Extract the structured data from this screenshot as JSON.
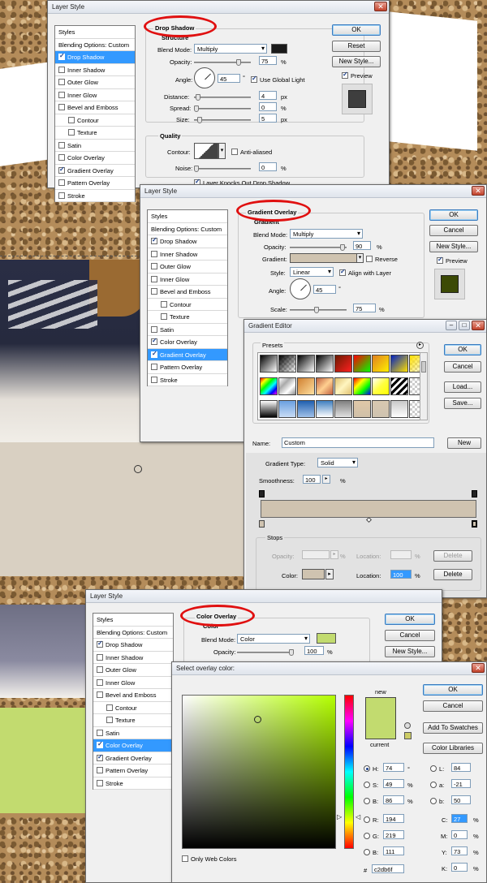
{
  "dialog1": {
    "title": "Layer Style",
    "section": "Drop Shadow",
    "subsection": "Structure",
    "styles_header": "Styles",
    "styles_items": [
      {
        "label": "Blending Options: Custom",
        "checkbox": false,
        "checked": false,
        "selected": false,
        "indent": false
      },
      {
        "label": "Drop Shadow",
        "checkbox": true,
        "checked": true,
        "selected": true,
        "indent": false
      },
      {
        "label": "Inner Shadow",
        "checkbox": true,
        "checked": false,
        "selected": false,
        "indent": false
      },
      {
        "label": "Outer Glow",
        "checkbox": true,
        "checked": false,
        "selected": false,
        "indent": false
      },
      {
        "label": "Inner Glow",
        "checkbox": true,
        "checked": false,
        "selected": false,
        "indent": false
      },
      {
        "label": "Bevel and Emboss",
        "checkbox": true,
        "checked": false,
        "selected": false,
        "indent": false
      },
      {
        "label": "Contour",
        "checkbox": true,
        "checked": false,
        "selected": false,
        "indent": true
      },
      {
        "label": "Texture",
        "checkbox": true,
        "checked": false,
        "selected": false,
        "indent": true
      },
      {
        "label": "Satin",
        "checkbox": true,
        "checked": false,
        "selected": false,
        "indent": false
      },
      {
        "label": "Color Overlay",
        "checkbox": true,
        "checked": false,
        "selected": false,
        "indent": false
      },
      {
        "label": "Gradient Overlay",
        "checkbox": true,
        "checked": true,
        "selected": false,
        "indent": false
      },
      {
        "label": "Pattern Overlay",
        "checkbox": true,
        "checked": false,
        "selected": false,
        "indent": false
      },
      {
        "label": "Stroke",
        "checkbox": true,
        "checked": false,
        "selected": false,
        "indent": false
      }
    ],
    "blend_mode_label": "Blend Mode:",
    "blend_mode": "Multiply",
    "opacity_label": "Opacity:",
    "opacity": "75",
    "angle_label": "Angle:",
    "angle": "45",
    "global_light": "Use Global Light",
    "distance_label": "Distance:",
    "distance": "4",
    "spread_label": "Spread:",
    "spread": "0",
    "size_label": "Size:",
    "size": "5",
    "quality": "Quality",
    "contour_label": "Contour:",
    "anti_aliased": "Anti-aliased",
    "noise_label": "Noise:",
    "noise": "0",
    "knockout": "Layer Knocks Out Drop Shadow",
    "ok": "OK",
    "reset": "Reset",
    "new_style": "New Style...",
    "preview": "Preview",
    "shadow_color": "#1a1a1a",
    "preview_color": "#3e3e3e"
  },
  "dialog2": {
    "title": "Layer Style",
    "section": "Gradient Overlay",
    "subsection": "Gradient",
    "styles_header": "Styles",
    "styles_items": [
      {
        "label": "Blending Options: Custom",
        "checkbox": false,
        "checked": false,
        "selected": false,
        "indent": false
      },
      {
        "label": "Drop Shadow",
        "checkbox": true,
        "checked": true,
        "selected": false,
        "indent": false
      },
      {
        "label": "Inner Shadow",
        "checkbox": true,
        "checked": false,
        "selected": false,
        "indent": false
      },
      {
        "label": "Outer Glow",
        "checkbox": true,
        "checked": false,
        "selected": false,
        "indent": false
      },
      {
        "label": "Inner Glow",
        "checkbox": true,
        "checked": false,
        "selected": false,
        "indent": false
      },
      {
        "label": "Bevel and Emboss",
        "checkbox": true,
        "checked": false,
        "selected": false,
        "indent": false
      },
      {
        "label": "Contour",
        "checkbox": true,
        "checked": false,
        "selected": false,
        "indent": true
      },
      {
        "label": "Texture",
        "checkbox": true,
        "checked": false,
        "selected": false,
        "indent": true
      },
      {
        "label": "Satin",
        "checkbox": true,
        "checked": false,
        "selected": false,
        "indent": false
      },
      {
        "label": "Color Overlay",
        "checkbox": true,
        "checked": true,
        "selected": false,
        "indent": false
      },
      {
        "label": "Gradient Overlay",
        "checkbox": true,
        "checked": true,
        "selected": true,
        "indent": false
      },
      {
        "label": "Pattern Overlay",
        "checkbox": true,
        "checked": false,
        "selected": false,
        "indent": false
      },
      {
        "label": "Stroke",
        "checkbox": true,
        "checked": false,
        "selected": false,
        "indent": false
      }
    ],
    "blend_mode_label": "Blend Mode:",
    "blend_mode": "Multiply",
    "opacity_label": "Opacity:",
    "opacity": "90",
    "gradient_label": "Gradient:",
    "reverse": "Reverse",
    "style_label": "Style:",
    "style": "Linear",
    "align": "Align with Layer",
    "angle_label": "Angle:",
    "angle": "45",
    "scale_label": "Scale:",
    "scale": "75",
    "ok": "OK",
    "cancel": "Cancel",
    "new_style": "New Style...",
    "preview": "Preview",
    "preview_color": "#3c4a06"
  },
  "gradient_editor": {
    "title": "Gradient Editor",
    "presets": "Presets",
    "ok": "OK",
    "cancel": "Cancel",
    "load": "Load...",
    "save": "Save...",
    "name_label": "Name:",
    "name": "Custom",
    "new": "New",
    "type_label": "Gradient Type:",
    "type": "Solid",
    "smoothness_label": "Smoothness:",
    "smoothness": "100",
    "stops": "Stops",
    "opacity_label": "Opacity:",
    "location_label": "Location:",
    "delete": "Delete",
    "color_label": "Color:",
    "location": "100",
    "gradient_color": "#cfc3b0"
  },
  "dialog3": {
    "title": "Layer Style",
    "section": "Color Overlay",
    "subsection": "Color",
    "styles_header": "Styles",
    "styles_items": [
      {
        "label": "Blending Options: Custom",
        "checkbox": false,
        "checked": false,
        "selected": false,
        "indent": false
      },
      {
        "label": "Drop Shadow",
        "checkbox": true,
        "checked": true,
        "selected": false,
        "indent": false
      },
      {
        "label": "Inner Shadow",
        "checkbox": true,
        "checked": false,
        "selected": false,
        "indent": false
      },
      {
        "label": "Outer Glow",
        "checkbox": true,
        "checked": false,
        "selected": false,
        "indent": false
      },
      {
        "label": "Inner Glow",
        "checkbox": true,
        "checked": false,
        "selected": false,
        "indent": false
      },
      {
        "label": "Bevel and Emboss",
        "checkbox": true,
        "checked": false,
        "selected": false,
        "indent": false
      },
      {
        "label": "Contour",
        "checkbox": true,
        "checked": false,
        "selected": false,
        "indent": true
      },
      {
        "label": "Texture",
        "checkbox": true,
        "checked": false,
        "selected": false,
        "indent": true
      },
      {
        "label": "Satin",
        "checkbox": true,
        "checked": false,
        "selected": false,
        "indent": false
      },
      {
        "label": "Color Overlay",
        "checkbox": true,
        "checked": true,
        "selected": true,
        "indent": false
      },
      {
        "label": "Gradient Overlay",
        "checkbox": true,
        "checked": true,
        "selected": false,
        "indent": false
      },
      {
        "label": "Pattern Overlay",
        "checkbox": true,
        "checked": false,
        "selected": false,
        "indent": false
      },
      {
        "label": "Stroke",
        "checkbox": true,
        "checked": false,
        "selected": false,
        "indent": false
      }
    ],
    "blend_mode_label": "Blend Mode:",
    "blend_mode": "Color",
    "opacity_label": "Opacity:",
    "opacity": "100",
    "ok": "OK",
    "cancel": "Cancel",
    "new_style": "New Style...",
    "overlay_color": "#c2db6f"
  },
  "color_picker": {
    "title": "Select overlay color:",
    "ok": "OK",
    "cancel": "Cancel",
    "add_swatches": "Add To Swatches",
    "color_libraries": "Color Libraries",
    "new_label": "new",
    "current_label": "current",
    "h_label": "H:",
    "h": "74",
    "h_unit": "°",
    "s_label": "S:",
    "s": "49",
    "s_unit": "%",
    "b_label": "B:",
    "b": "86",
    "b_unit": "%",
    "r_label": "R:",
    "r": "194",
    "g_label": "G:",
    "g": "219",
    "bl_label": "B:",
    "bl": "111",
    "l_label": "L:",
    "l": "84",
    "a_label": "a:",
    "a": "-21",
    "lb_label": "b:",
    "lb": "50",
    "c_label": "C:",
    "c": "27",
    "m_label": "M:",
    "m": "0",
    "y_label": "Y:",
    "y": "73",
    "k_label": "K:",
    "k": "0",
    "pct": "%",
    "hex_label": "#",
    "hex": "c2db6f",
    "web_only": "Only Web Colors",
    "new_color": "#c2db6f",
    "current_color": "#c2db6f"
  }
}
